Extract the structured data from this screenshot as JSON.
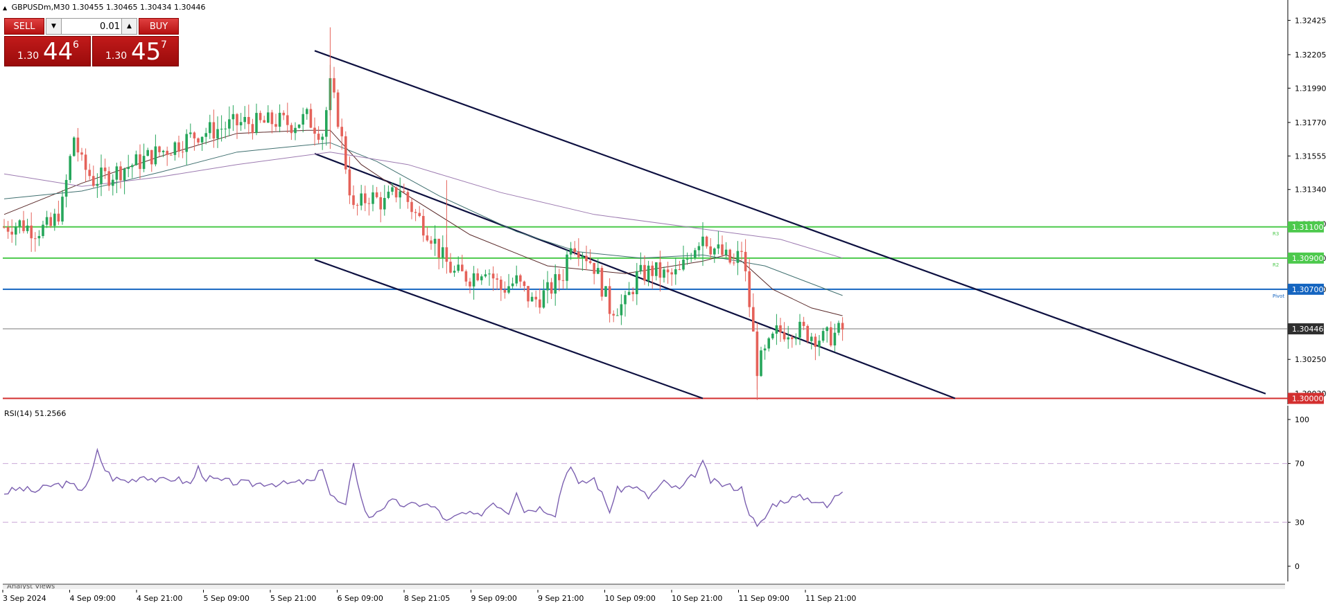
{
  "symbol_info": "GBPUSDm,M30  1.30455 1.30465 1.30434 1.30446",
  "trade_panel": {
    "sell_label": "SELL",
    "buy_label": "BUY",
    "lot": "0.01",
    "sell_price_small": "1.30",
    "sell_price_big": "44",
    "sell_price_sup": "6",
    "buy_price_small": "1.30",
    "buy_price_big": "45",
    "buy_price_sup": "7"
  },
  "price_axis": {
    "ticks": [
      "1.32425",
      "1.32205",
      "1.31990",
      "1.31770",
      "1.31555",
      "1.31340",
      "1.31120",
      "1.30900",
      "1.30700",
      "1.30446",
      "1.30250",
      "1.30030"
    ],
    "current_price": "1.30446"
  },
  "levels": [
    {
      "price_label": "1.31100",
      "name": "R3",
      "color": "#4cc94c"
    },
    {
      "price_label": "1.30900",
      "name": "R2",
      "color": "#4cc94c"
    },
    {
      "price_label": "1.30700",
      "name": "Pivot",
      "color": "#1565c0"
    },
    {
      "price_label": "1.30000",
      "name": "",
      "color": "#d32f2f"
    }
  ],
  "rsi": {
    "label": "RSI(14) 51.2566",
    "ticks": [
      "100",
      "70",
      "30",
      "0"
    ]
  },
  "time_axis": [
    "3 Sep 2024",
    "4 Sep 09:00",
    "4 Sep 21:00",
    "5 Sep 09:00",
    "5 Sep 21:00",
    "6 Sep 09:00",
    "8 Sep 21:05",
    "9 Sep 09:00",
    "9 Sep 21:00",
    "10 Sep 09:00",
    "10 Sep 21:00",
    "11 Sep 09:00",
    "11 Sep 21:00"
  ],
  "analyst_label": "Analyst Views",
  "colors": {
    "bull": "#26a65b",
    "bear": "#e5625a",
    "channel": "#0d1040",
    "rsi_line": "#7b5fb0",
    "ma_dark": "#5a2a2a",
    "ma_teal": "#3f6f6f",
    "ma_purple": "#9c7ab0"
  },
  "chart_data": {
    "type": "candlestick",
    "title": "GBPUSDm,M30",
    "ohlc_last": {
      "open": 1.30455,
      "high": 1.30465,
      "low": 1.30434,
      "close": 1.30446
    },
    "ylim": [
      1.2998,
      1.3252
    ],
    "close_path": [
      [
        0,
        1.311
      ],
      [
        4,
        1.3112
      ],
      [
        8,
        1.3108
      ],
      [
        12,
        1.311
      ],
      [
        15,
        1.3124
      ],
      [
        18,
        1.3168
      ],
      [
        20,
        1.315
      ],
      [
        23,
        1.314
      ],
      [
        27,
        1.3143
      ],
      [
        31,
        1.3148
      ],
      [
        35,
        1.3152
      ],
      [
        38,
        1.3156
      ],
      [
        42,
        1.316
      ],
      [
        46,
        1.3165
      ],
      [
        50,
        1.317
      ],
      [
        54,
        1.3172
      ],
      [
        58,
        1.3175
      ],
      [
        62,
        1.3177
      ],
      [
        66,
        1.3176
      ],
      [
        70,
        1.3178
      ],
      [
        74,
        1.3176
      ],
      [
        78,
        1.318
      ],
      [
        82,
        1.317
      ],
      [
        84,
        1.32
      ],
      [
        86,
        1.318
      ],
      [
        88,
        1.315
      ],
      [
        90,
        1.312
      ],
      [
        94,
        1.313
      ],
      [
        98,
        1.3125
      ],
      [
        102,
        1.3135
      ],
      [
        106,
        1.3118
      ],
      [
        110,
        1.3105
      ],
      [
        113,
        1.309
      ],
      [
        116,
        1.308
      ],
      [
        120,
        1.3078
      ],
      [
        124,
        1.3085
      ],
      [
        128,
        1.307
      ],
      [
        132,
        1.3075
      ],
      [
        136,
        1.3062
      ],
      [
        140,
        1.3068
      ],
      [
        144,
        1.308
      ],
      [
        146,
        1.3102
      ],
      [
        149,
        1.3095
      ],
      [
        152,
        1.3085
      ],
      [
        154,
        1.3072
      ],
      [
        156,
        1.3058
      ],
      [
        160,
        1.306
      ],
      [
        163,
        1.3078
      ],
      [
        167,
        1.3082
      ],
      [
        171,
        1.3078
      ],
      [
        174,
        1.308
      ],
      [
        177,
        1.3095
      ],
      [
        180,
        1.3106
      ],
      [
        182,
        1.3098
      ],
      [
        185,
        1.3092
      ],
      [
        188,
        1.3085
      ],
      [
        190,
        1.3096
      ],
      [
        192,
        1.306
      ],
      [
        194,
        1.302
      ],
      [
        196,
        1.3028
      ],
      [
        199,
        1.3042
      ],
      [
        203,
        1.3045
      ],
      [
        207,
        1.3042
      ],
      [
        211,
        1.3038
      ],
      [
        214,
        1.3041
      ],
      [
        216,
        1.3044
      ]
    ],
    "moving_averages": [
      {
        "color": "ma_dark",
        "path": [
          [
            0,
            1.3118
          ],
          [
            20,
            1.3138
          ],
          [
            40,
            1.3155
          ],
          [
            60,
            1.317
          ],
          [
            78,
            1.3172
          ],
          [
            84,
            1.3172
          ],
          [
            92,
            1.315
          ],
          [
            104,
            1.313
          ],
          [
            120,
            1.3105
          ],
          [
            140,
            1.3085
          ],
          [
            160,
            1.308
          ],
          [
            180,
            1.3088
          ],
          [
            186,
            1.3092
          ],
          [
            190,
            1.3088
          ],
          [
            198,
            1.307
          ],
          [
            208,
            1.3058
          ],
          [
            216,
            1.3053
          ]
        ]
      },
      {
        "color": "ma_teal",
        "path": [
          [
            0,
            1.3128
          ],
          [
            20,
            1.3133
          ],
          [
            40,
            1.3145
          ],
          [
            60,
            1.3158
          ],
          [
            84,
            1.3164
          ],
          [
            96,
            1.3152
          ],
          [
            112,
            1.313
          ],
          [
            132,
            1.3107
          ],
          [
            148,
            1.3094
          ],
          [
            164,
            1.309
          ],
          [
            180,
            1.3092
          ],
          [
            196,
            1.3085
          ],
          [
            216,
            1.3066
          ]
        ]
      },
      {
        "color": "ma_purple",
        "path": [
          [
            0,
            1.3144
          ],
          [
            20,
            1.3136
          ],
          [
            40,
            1.3142
          ],
          [
            60,
            1.315
          ],
          [
            84,
            1.3158
          ],
          [
            104,
            1.315
          ],
          [
            128,
            1.3132
          ],
          [
            152,
            1.3118
          ],
          [
            176,
            1.311
          ],
          [
            200,
            1.3102
          ],
          [
            216,
            1.309
          ]
        ]
      }
    ],
    "channel_lines": [
      {
        "from": [
          80,
          1.3223
        ],
        "to": [
          325,
          1.3003
        ]
      },
      {
        "from": [
          80,
          1.3157
        ],
        "to": [
          245,
          1.3
        ]
      },
      {
        "from": [
          80,
          1.3089
        ],
        "to": [
          180,
          1.3
        ]
      }
    ],
    "rsi_values": [
      [
        0,
        50
      ],
      [
        4,
        53
      ],
      [
        8,
        51
      ],
      [
        12,
        55
      ],
      [
        16,
        56
      ],
      [
        20,
        53
      ],
      [
        22,
        58
      ],
      [
        24,
        78
      ],
      [
        26,
        66
      ],
      [
        28,
        60
      ],
      [
        32,
        58
      ],
      [
        36,
        62
      ],
      [
        40,
        58
      ],
      [
        44,
        60
      ],
      [
        48,
        56
      ],
      [
        50,
        67
      ],
      [
        52,
        60
      ],
      [
        56,
        58
      ],
      [
        60,
        57
      ],
      [
        64,
        56
      ],
      [
        68,
        57
      ],
      [
        72,
        56
      ],
      [
        76,
        57
      ],
      [
        80,
        58
      ],
      [
        82,
        68
      ],
      [
        84,
        49
      ],
      [
        86,
        44
      ],
      [
        88,
        40
      ],
      [
        90,
        72
      ],
      [
        92,
        46
      ],
      [
        94,
        32
      ],
      [
        96,
        38
      ],
      [
        100,
        44
      ],
      [
        104,
        41
      ],
      [
        108,
        43
      ],
      [
        112,
        38
      ],
      [
        114,
        30
      ],
      [
        118,
        36
      ],
      [
        122,
        34
      ],
      [
        126,
        44
      ],
      [
        130,
        37
      ],
      [
        132,
        52
      ],
      [
        134,
        38
      ],
      [
        138,
        40
      ],
      [
        142,
        36
      ],
      [
        144,
        58
      ],
      [
        146,
        70
      ],
      [
        148,
        55
      ],
      [
        152,
        60
      ],
      [
        156,
        38
      ],
      [
        158,
        52
      ],
      [
        162,
        55
      ],
      [
        166,
        47
      ],
      [
        170,
        57
      ],
      [
        174,
        52
      ],
      [
        178,
        63
      ],
      [
        180,
        70
      ],
      [
        182,
        58
      ],
      [
        186,
        55
      ],
      [
        190,
        53
      ],
      [
        192,
        37
      ],
      [
        194,
        26
      ],
      [
        196,
        33
      ],
      [
        198,
        42
      ],
      [
        202,
        46
      ],
      [
        206,
        47
      ],
      [
        210,
        44
      ],
      [
        212,
        40
      ],
      [
        214,
        47
      ],
      [
        216,
        52
      ]
    ],
    "rsi_levels": [
      70,
      30
    ]
  }
}
